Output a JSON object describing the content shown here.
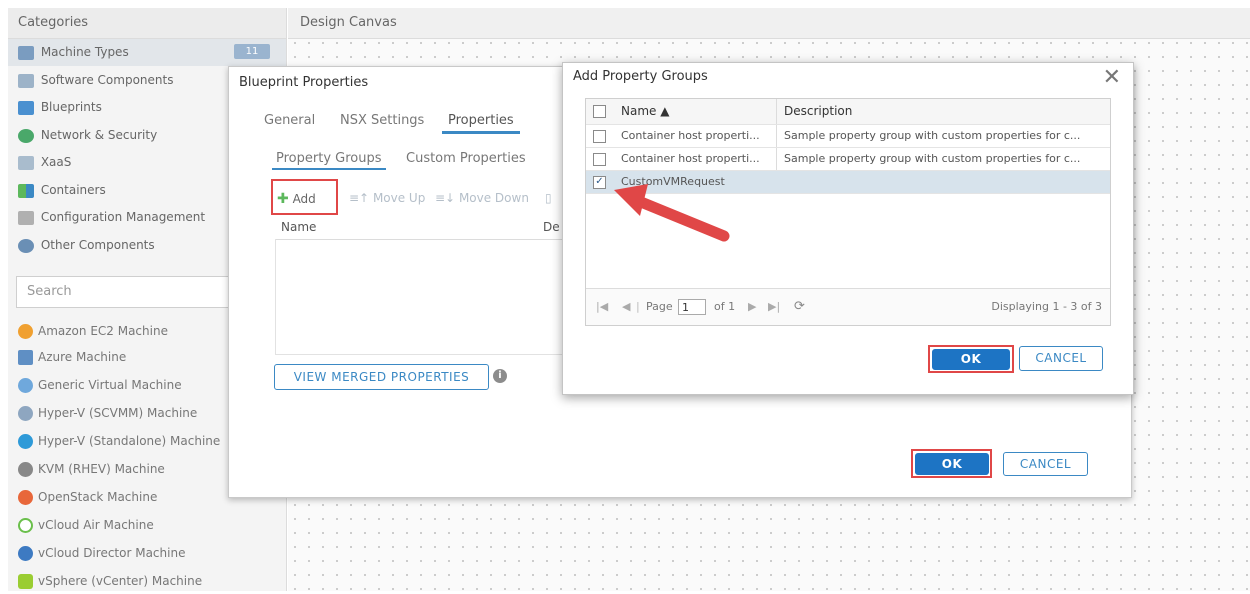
{
  "left_panel": {
    "header": "Categories",
    "categories": [
      {
        "label": "Machine Types",
        "icon": "machine-types-icon",
        "count": "11"
      },
      {
        "label": "Software Components",
        "icon": "software-components-icon"
      },
      {
        "label": "Blueprints",
        "icon": "blueprints-icon"
      },
      {
        "label": "Network & Security",
        "icon": "network-security-icon"
      },
      {
        "label": "XaaS",
        "icon": "xaas-icon"
      },
      {
        "label": "Containers",
        "icon": "containers-icon"
      },
      {
        "label": "Configuration Management",
        "icon": "configuration-management-icon"
      },
      {
        "label": "Other Components",
        "icon": "other-components-icon"
      }
    ],
    "search_placeholder": "Search",
    "machines": [
      {
        "label": "Amazon EC2 Machine",
        "color": "#f0a030"
      },
      {
        "label": "Azure Machine",
        "color": "#5f8fc4"
      },
      {
        "label": "Generic Virtual Machine",
        "color": "#6fa8dc"
      },
      {
        "label": "Hyper-V (SCVMM) Machine",
        "color": "#8ea6c0"
      },
      {
        "label": "Hyper-V (Standalone) Machine",
        "color": "#2e9ad8"
      },
      {
        "label": "KVM (RHEV) Machine",
        "color": "#888888"
      },
      {
        "label": "OpenStack Machine",
        "color": "#e8673a"
      },
      {
        "label": "vCloud Air Machine",
        "color": "#6abf4b"
      },
      {
        "label": "vCloud Director Machine",
        "color": "#3d7ac2"
      },
      {
        "label": "vSphere (vCenter) Machine",
        "color": "#9acd32"
      }
    ]
  },
  "canvas": {
    "header": "Design Canvas"
  },
  "blueprint_properties": {
    "title": "Blueprint Properties",
    "tabs": [
      "General",
      "NSX Settings",
      "Properties"
    ],
    "active_tab": "Properties",
    "subtabs": [
      "Property Groups",
      "Custom Properties"
    ],
    "toolbar": {
      "add": "Add",
      "move_up": "Move Up",
      "move_down": "Move Down"
    },
    "grid_columns": [
      "Name",
      "De"
    ],
    "view_merged": "VIEW MERGED PROPERTIES",
    "ok": "OK",
    "cancel": "CANCEL"
  },
  "add_property_groups": {
    "title": "Add Property Groups",
    "columns": {
      "name": "Name ▲",
      "description": "Description"
    },
    "rows": [
      {
        "name": "Container host properti...",
        "description": "Sample property group with custom properties for c...",
        "checked": false
      },
      {
        "name": "Container host properti...",
        "description": "Sample property group with custom properties for c...",
        "checked": false
      },
      {
        "name": "CustomVMRequest",
        "description": "",
        "checked": true
      }
    ],
    "pager": {
      "page_label": "Page",
      "page_value": "1",
      "of_label": "of 1",
      "display": "Displaying 1 - 3 of 3"
    },
    "ok": "OK",
    "cancel": "CANCEL"
  },
  "colors": {
    "accent": "#1d74c4",
    "highlight": "#e04747",
    "add_green": "#5cb85c"
  }
}
